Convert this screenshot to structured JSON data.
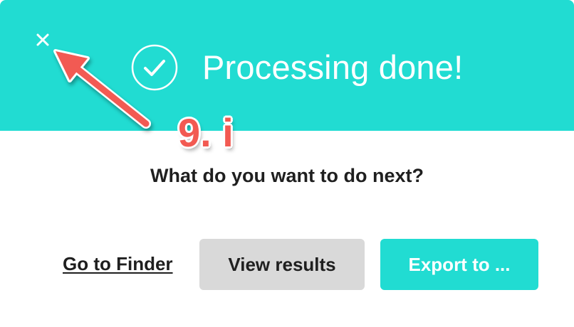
{
  "header": {
    "title": "Processing done!",
    "background_color": "#21dcd2",
    "status_icon": "check-circle-icon",
    "close_icon": "close-icon"
  },
  "body": {
    "question": "What do you want to do next?"
  },
  "actions": {
    "finder_link": "Go to Finder",
    "view_results": "View results",
    "export": "Export to ..."
  },
  "annotation": {
    "step_label": "9. i",
    "color": "#f25a52",
    "arrow_icon": "arrow-pointer-icon"
  }
}
